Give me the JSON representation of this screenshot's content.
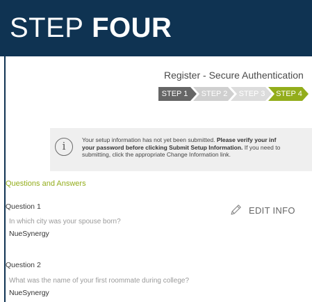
{
  "banner": {
    "title_light": "STEP",
    "title_bold": "FOUR",
    "colors": {
      "background": "#0f3352",
      "text": "#ffffff"
    }
  },
  "registration": {
    "title": "Register - Secure Authentication",
    "steps": [
      {
        "label": "STEP 1",
        "state": "completed",
        "color": "#666666"
      },
      {
        "label": "STEP 2",
        "state": "inactive",
        "color": "#cfcfcf"
      },
      {
        "label": "STEP 3",
        "state": "inactive",
        "color": "#dcdcdc"
      },
      {
        "label": "STEP 4",
        "state": "active",
        "color": "#93ad1b"
      }
    ]
  },
  "info_notice": {
    "icon": "info-icon",
    "icon_glyph": "i",
    "line1_plain": "Your setup information has not yet been submitted. ",
    "line1_bold": "Please verify your inf",
    "line2_bold": "your password before clicking Submit Setup Information.",
    "line2_plain": " If you need to",
    "line3_plain": "submitting, click the appropriate Change Information link."
  },
  "qa_section": {
    "title": "Questions and Answers",
    "edit_label": "EDIT INFO",
    "edit_icon": "pencil-icon",
    "accent_color": "#93ad1b",
    "questions": [
      {
        "label": "Question 1",
        "question": "In which city was your spouse born?",
        "answer": "NueSynergy"
      },
      {
        "label": "Question 2",
        "question": "What was the name of your first roommate during college?",
        "answer": "NueSynergy"
      }
    ]
  }
}
